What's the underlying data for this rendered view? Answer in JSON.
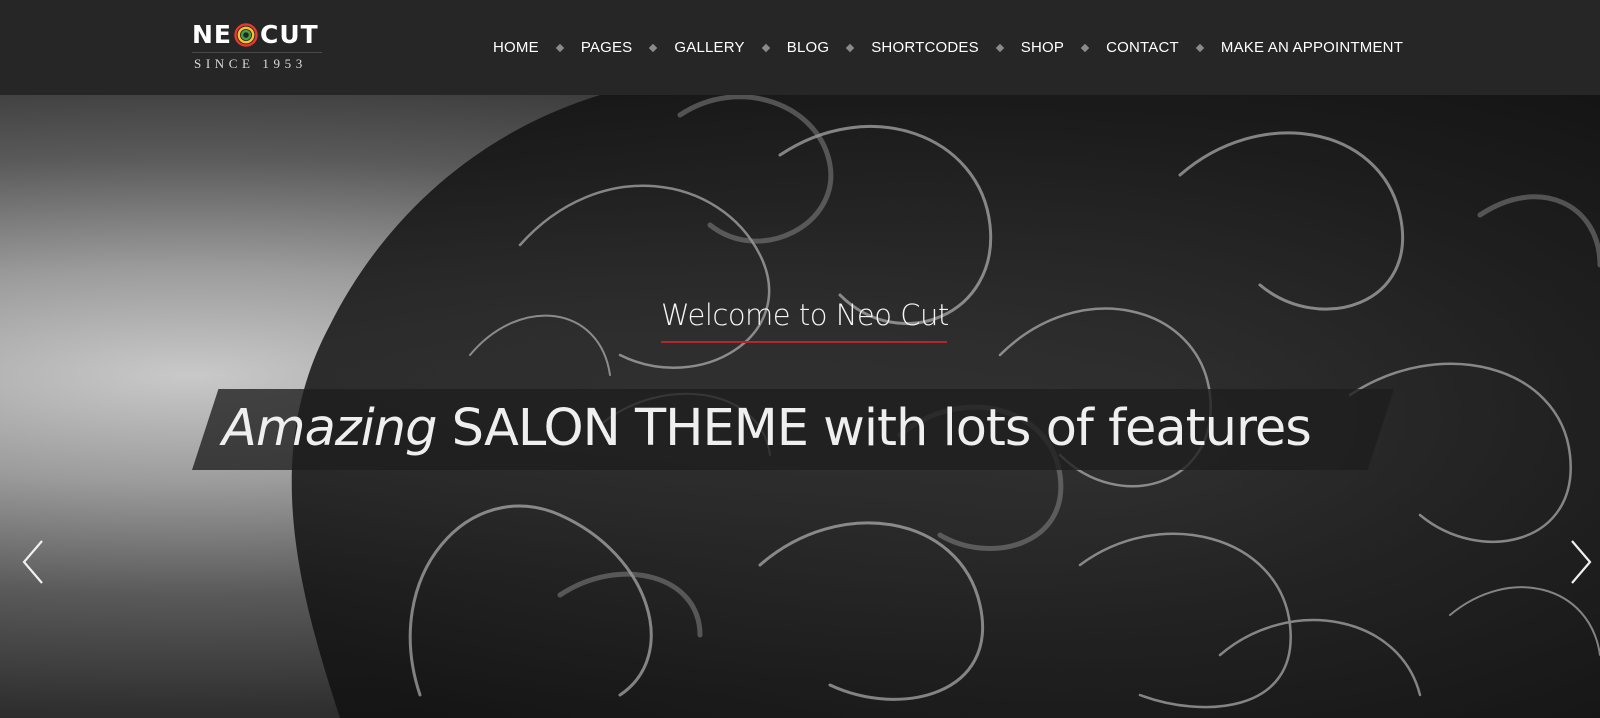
{
  "header": {
    "logo": {
      "word_left": "NE",
      "word_right": "CUT",
      "tagline": "SINCE 1953",
      "ring_colors": [
        "#e53935",
        "#fbc02d",
        "#43a047"
      ]
    },
    "nav": {
      "items": [
        {
          "label": "HOME",
          "active": true
        },
        {
          "label": "PAGES"
        },
        {
          "label": "GALLERY"
        },
        {
          "label": "BLOG"
        },
        {
          "label": "SHORTCODES"
        },
        {
          "label": "SHOP"
        },
        {
          "label": "CONTACT"
        },
        {
          "label": "MAKE AN APPOINTMENT"
        }
      ]
    }
  },
  "hero": {
    "welcome": "Welcome to Neo Cut",
    "headline_em": "Amazing",
    "headline_rest": " SALON THEME with lots of features",
    "accent_color": "#b0282b",
    "prev_icon": "chevron-left-icon",
    "next_icon": "chevron-right-icon"
  }
}
